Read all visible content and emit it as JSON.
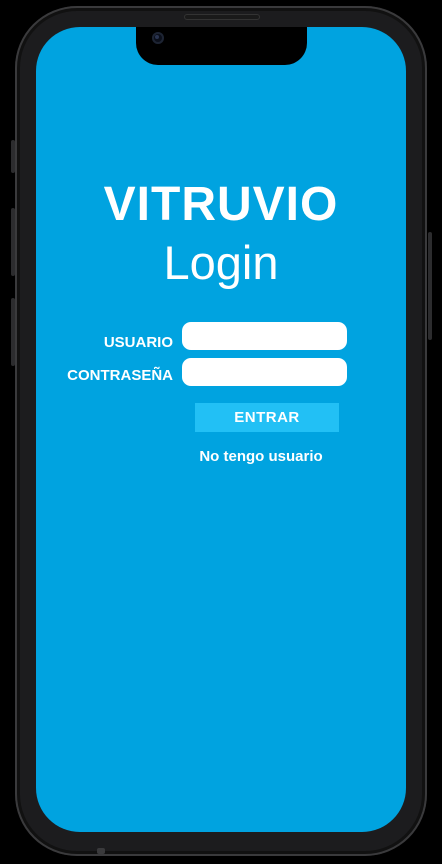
{
  "app": {
    "name": "VITRUVIO",
    "screen_title": "Login"
  },
  "form": {
    "username_label": "USUARIO",
    "username_value": "",
    "password_label": "CONTRASEÑA",
    "password_value": "",
    "submit_label": "ENTRAR",
    "no_account_link": "No tengo usuario"
  },
  "colors": {
    "screen_background": "#00a3e0",
    "button_background": "#22c0f5",
    "text": "#ffffff",
    "input_background": "#ffffff"
  }
}
